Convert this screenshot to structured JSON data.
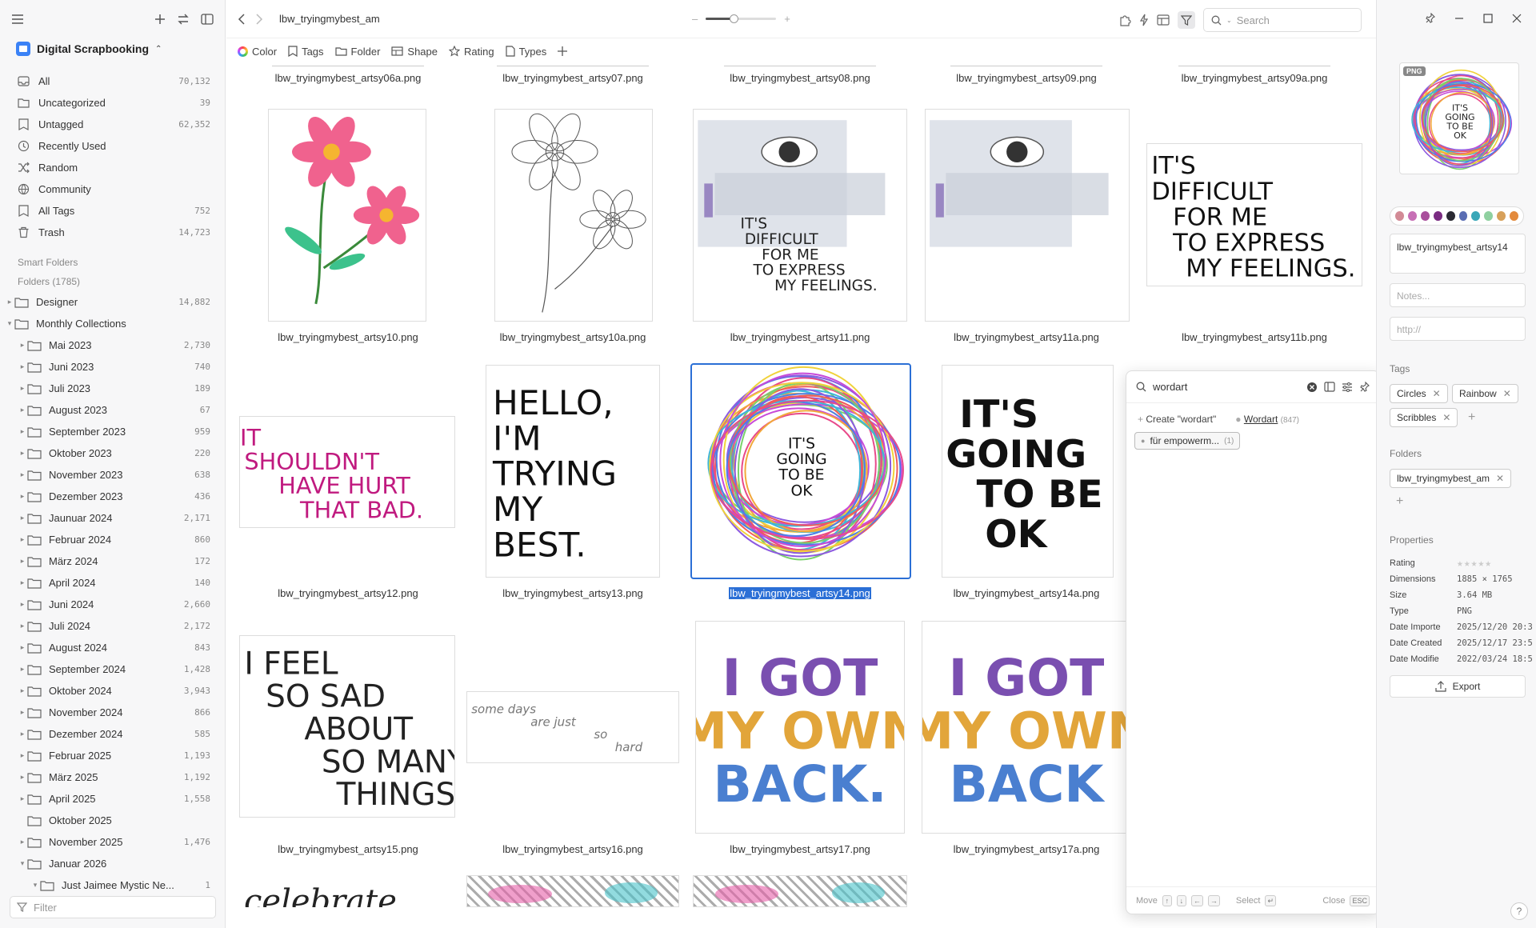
{
  "library": {
    "name": "Digital Scrapbooking"
  },
  "sidebar": {
    "items": [
      {
        "label": "All",
        "count": "70,132",
        "icon": "inbox-icon"
      },
      {
        "label": "Uncategorized",
        "count": "39",
        "icon": "folder-outline-icon"
      },
      {
        "label": "Untagged",
        "count": "62,352",
        "icon": "tag-off-icon"
      },
      {
        "label": "Recently Used",
        "count": "",
        "icon": "clock-icon"
      },
      {
        "label": "Random",
        "count": "",
        "icon": "shuffle-icon"
      },
      {
        "label": "Community",
        "count": "",
        "icon": "globe-icon"
      },
      {
        "label": "All Tags",
        "count": "752",
        "icon": "tag-icon"
      },
      {
        "label": "Trash",
        "count": "14,723",
        "icon": "trash-icon"
      }
    ],
    "smart_folders_label": "Smart Folders",
    "folders_label": "Folders (1785)",
    "folders": [
      {
        "label": "Designer",
        "count": "14,882",
        "level": 0,
        "caret": "▸"
      },
      {
        "label": "Monthly Collections",
        "count": "",
        "level": 0,
        "caret": "▾"
      },
      {
        "label": "Mai 2023",
        "count": "2,730",
        "level": 1,
        "caret": "▸"
      },
      {
        "label": "Juni 2023",
        "count": "740",
        "level": 1,
        "caret": "▸"
      },
      {
        "label": "Juli 2023",
        "count": "189",
        "level": 1,
        "caret": "▸"
      },
      {
        "label": "August 2023",
        "count": "67",
        "level": 1,
        "caret": "▸"
      },
      {
        "label": "September 2023",
        "count": "959",
        "level": 1,
        "caret": "▸"
      },
      {
        "label": "Oktober 2023",
        "count": "220",
        "level": 1,
        "caret": "▸"
      },
      {
        "label": "November 2023",
        "count": "638",
        "level": 1,
        "caret": "▸"
      },
      {
        "label": "Dezember 2023",
        "count": "436",
        "level": 1,
        "caret": "▸"
      },
      {
        "label": "Jaunuar 2024",
        "count": "2,171",
        "level": 1,
        "caret": "▸"
      },
      {
        "label": "Februar 2024",
        "count": "860",
        "level": 1,
        "caret": "▸"
      },
      {
        "label": "März 2024",
        "count": "172",
        "level": 1,
        "caret": "▸"
      },
      {
        "label": "April 2024",
        "count": "140",
        "level": 1,
        "caret": "▸"
      },
      {
        "label": "Juni 2024",
        "count": "2,660",
        "level": 1,
        "caret": "▸"
      },
      {
        "label": "Juli 2024",
        "count": "2,172",
        "level": 1,
        "caret": "▸"
      },
      {
        "label": "August 2024",
        "count": "843",
        "level": 1,
        "caret": "▸"
      },
      {
        "label": "September 2024",
        "count": "1,428",
        "level": 1,
        "caret": "▸"
      },
      {
        "label": "Oktober 2024",
        "count": "3,943",
        "level": 1,
        "caret": "▸"
      },
      {
        "label": "November 2024",
        "count": "866",
        "level": 1,
        "caret": "▸"
      },
      {
        "label": "Dezember 2024",
        "count": "585",
        "level": 1,
        "caret": "▸"
      },
      {
        "label": "Februar 2025",
        "count": "1,193",
        "level": 1,
        "caret": "▸"
      },
      {
        "label": "März 2025",
        "count": "1,192",
        "level": 1,
        "caret": "▸"
      },
      {
        "label": "April 2025",
        "count": "1,558",
        "level": 1,
        "caret": "▸"
      },
      {
        "label": "Oktober 2025",
        "count": "",
        "level": 1,
        "caret": ""
      },
      {
        "label": "November 2025",
        "count": "1,476",
        "level": 1,
        "caret": "▸"
      },
      {
        "label": "Januar 2026",
        "count": "",
        "level": 1,
        "caret": "▾"
      },
      {
        "label": "Just Jaimee Mystic Ne...",
        "count": "1",
        "level": 2,
        "caret": "▾"
      }
    ],
    "filter_placeholder": "Filter"
  },
  "toolbar": {
    "path": "lbw_tryingmybest_am",
    "search_placeholder": "Search",
    "zoom": 0.4
  },
  "filterbar": {
    "color": "Color",
    "tags": "Tags",
    "folder": "Folder",
    "shape": "Shape",
    "rating": "Rating",
    "types": "Types"
  },
  "grid": {
    "top_row": [
      "lbw_tryingmybest_artsy06a.png",
      "lbw_tryingmybest_artsy07.png",
      "lbw_tryingmybest_artsy08.png",
      "lbw_tryingmybest_artsy09.png",
      "lbw_tryingmybest_artsy09a.png"
    ],
    "items": [
      {
        "name": "lbw_tryingmybest_artsy10.png",
        "art": "pink-flowers-artwork"
      },
      {
        "name": "lbw_tryingmybest_artsy10a.png",
        "art": "sketch-flowers-artwork"
      },
      {
        "name": "lbw_tryingmybest_artsy11.png",
        "art": "eye-wordart-artwork",
        "text": [
          "IT'S",
          "DIFFICULT",
          "FOR ME",
          "TO EXPRESS",
          "MY FEELINGS."
        ]
      },
      {
        "name": "lbw_tryingmybest_artsy11a.png",
        "art": "eye-artwork"
      },
      {
        "name": "lbw_tryingmybest_artsy11b.png",
        "art": "wordart",
        "text": [
          "IT'S",
          "DIFFICULT",
          "FOR ME",
          "TO EXPRESS",
          "MY FEELINGS."
        ]
      },
      {
        "name": "lbw_tryingmybest_artsy12.png",
        "art": "wordart",
        "text": [
          "IT",
          "SHOULDN'T",
          "HAVE HURT",
          "THAT BAD."
        ]
      },
      {
        "name": "lbw_tryingmybest_artsy13.png",
        "art": "wordart",
        "text": [
          "HELLO,",
          "I'M",
          "TRYING",
          "MY",
          "BEST."
        ]
      },
      {
        "name": "lbw_tryingmybest_artsy14.png",
        "art": "circles-wordart",
        "text": [
          "IT'S",
          "GOING",
          "TO BE",
          "OK"
        ],
        "selected": true
      },
      {
        "name": "lbw_tryingmybest_artsy14a.png",
        "art": "wordart",
        "text": [
          "IT'S",
          "GOING",
          "TO BE",
          "OK"
        ]
      },
      {
        "name": "lbw_tryingmybest_artsy15.png",
        "art": "wordart",
        "text": [
          "I FEEL",
          "SO SAD",
          "ABOUT",
          "SO MANY",
          "THINGS"
        ]
      },
      {
        "name": "lbw_tryingmybest_artsy16.png",
        "art": "wordart",
        "text": [
          "some days",
          "are just",
          "so",
          "hard"
        ]
      },
      {
        "name": "lbw_tryingmybest_artsy17.png",
        "art": "wordart",
        "text": [
          "I GOT",
          "MY OWN",
          "BACK."
        ]
      },
      {
        "name": "lbw_tryingmybest_artsy17a.png",
        "art": "wordart",
        "text": [
          "I GOT",
          "MY OWN",
          "BACK"
        ]
      }
    ],
    "bottom_partial": {
      "text": "celebrate"
    }
  },
  "tag_popup": {
    "query": "wordart",
    "create_label": "Create \"wordart\"",
    "suggestion": {
      "name": "Wordart",
      "count": "(847)"
    },
    "chip": {
      "name": "für empowerm...",
      "count": "(1)"
    },
    "footer": {
      "move": "Move",
      "select": "Select",
      "close": "Close",
      "esc": "ESC"
    }
  },
  "inspector": {
    "badge": "PNG",
    "palette": [
      "#d28b96",
      "#c76fb5",
      "#a94f9c",
      "#7a2c82",
      "#2a2a33",
      "#5a6db3",
      "#3aa7b8",
      "#8fd0a0",
      "#d7a05a",
      "#e38a3c"
    ],
    "title_value": "lbw_tryingmybest_artsy14",
    "notes_placeholder": "Notes...",
    "url_placeholder": "http://",
    "tags_label": "Tags",
    "tags": [
      "Circles",
      "Rainbow",
      "Scribbles"
    ],
    "folders_label": "Folders",
    "folder": "lbw_tryingmybest_am",
    "properties_label": "Properties",
    "properties": [
      {
        "k": "Rating",
        "v": "★★★★★"
      },
      {
        "k": "Dimensions",
        "v": "1885 × 1765"
      },
      {
        "k": "Size",
        "v": "3.64 MB"
      },
      {
        "k": "Type",
        "v": "PNG"
      },
      {
        "k": "Date Importe",
        "v": "2025/12/20 20:3"
      },
      {
        "k": "Date Created",
        "v": "2025/12/17 23:5"
      },
      {
        "k": "Date Modifie",
        "v": "2022/03/24 18:5"
      }
    ],
    "export_label": "Export",
    "help": "?"
  }
}
